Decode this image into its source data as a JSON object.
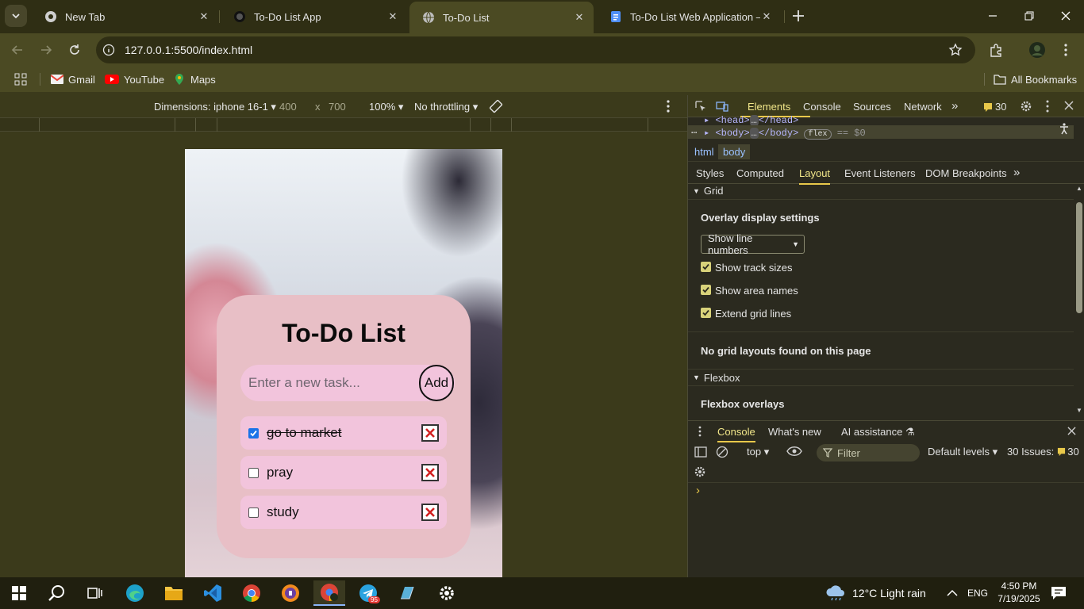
{
  "browser": {
    "tabs": [
      {
        "title": "New Tab",
        "icon": "chrome-icon"
      },
      {
        "title": "To-Do List App",
        "icon": "github-icon"
      },
      {
        "title": "To-Do List",
        "icon": "globe-icon"
      },
      {
        "title": "To-Do List Web Application – Ta",
        "icon": "google-docs-icon"
      }
    ],
    "url": "127.0.0.1:5500/index.html",
    "bookmarks": {
      "gmail": "Gmail",
      "youtube": "YouTube",
      "maps": "Maps",
      "all": "All Bookmarks"
    }
  },
  "device_toolbar": {
    "dimensions": "Dimensions: iphone 16-1",
    "width": "400",
    "times": "x",
    "height": "700",
    "zoom": "100%",
    "throttling": "No throttling"
  },
  "app": {
    "title": "To-Do List",
    "placeholder": "Enter a new task...",
    "add_label": "Add",
    "tasks": [
      {
        "text": "go to market",
        "done": true
      },
      {
        "text": "pray",
        "done": false
      },
      {
        "text": "study",
        "done": false
      }
    ]
  },
  "devtools": {
    "tabs": {
      "elements": "Elements",
      "console": "Console",
      "sources": "Sources",
      "network": "Network"
    },
    "issues_count": "30",
    "dom": {
      "head": "<head>",
      "head_close": "</head>",
      "body_open": "<body>",
      "body_close": "</body>",
      "flex_badge": "flex",
      "eq": "== $0"
    },
    "breadcrumbs": [
      "html",
      "body"
    ],
    "subtabs": {
      "styles": "Styles",
      "computed": "Computed",
      "layout": "Layout",
      "events": "Event Listeners",
      "dom_bp": "DOM Breakpoints"
    },
    "grid": {
      "heading": "Grid",
      "overlay": "Overlay display settings",
      "select": "Show line numbers",
      "opt1": "Show track sizes",
      "opt2": "Show area names",
      "opt3": "Extend grid lines",
      "none": "No grid layouts found on this page"
    },
    "flexbox": {
      "heading": "Flexbox",
      "overlays": "Flexbox overlays"
    },
    "drawer": {
      "console": "Console",
      "whatsnew": "What's new",
      "ai": "AI assistance"
    },
    "console_toolbar": {
      "context": "top",
      "filter": "Filter",
      "levels": "Default levels",
      "issues": "30 Issues:",
      "issues_n": "30"
    },
    "prompt": "›"
  },
  "taskbar": {
    "weather": "12°C  Light rain",
    "lang": "ENG",
    "time": "4:50 PM",
    "date": "7/19/2025",
    "telegram_badge": "95"
  },
  "colors": {
    "card": "#e8bfc6",
    "input": "#f2c4dc",
    "accent": "#f2e78a"
  }
}
